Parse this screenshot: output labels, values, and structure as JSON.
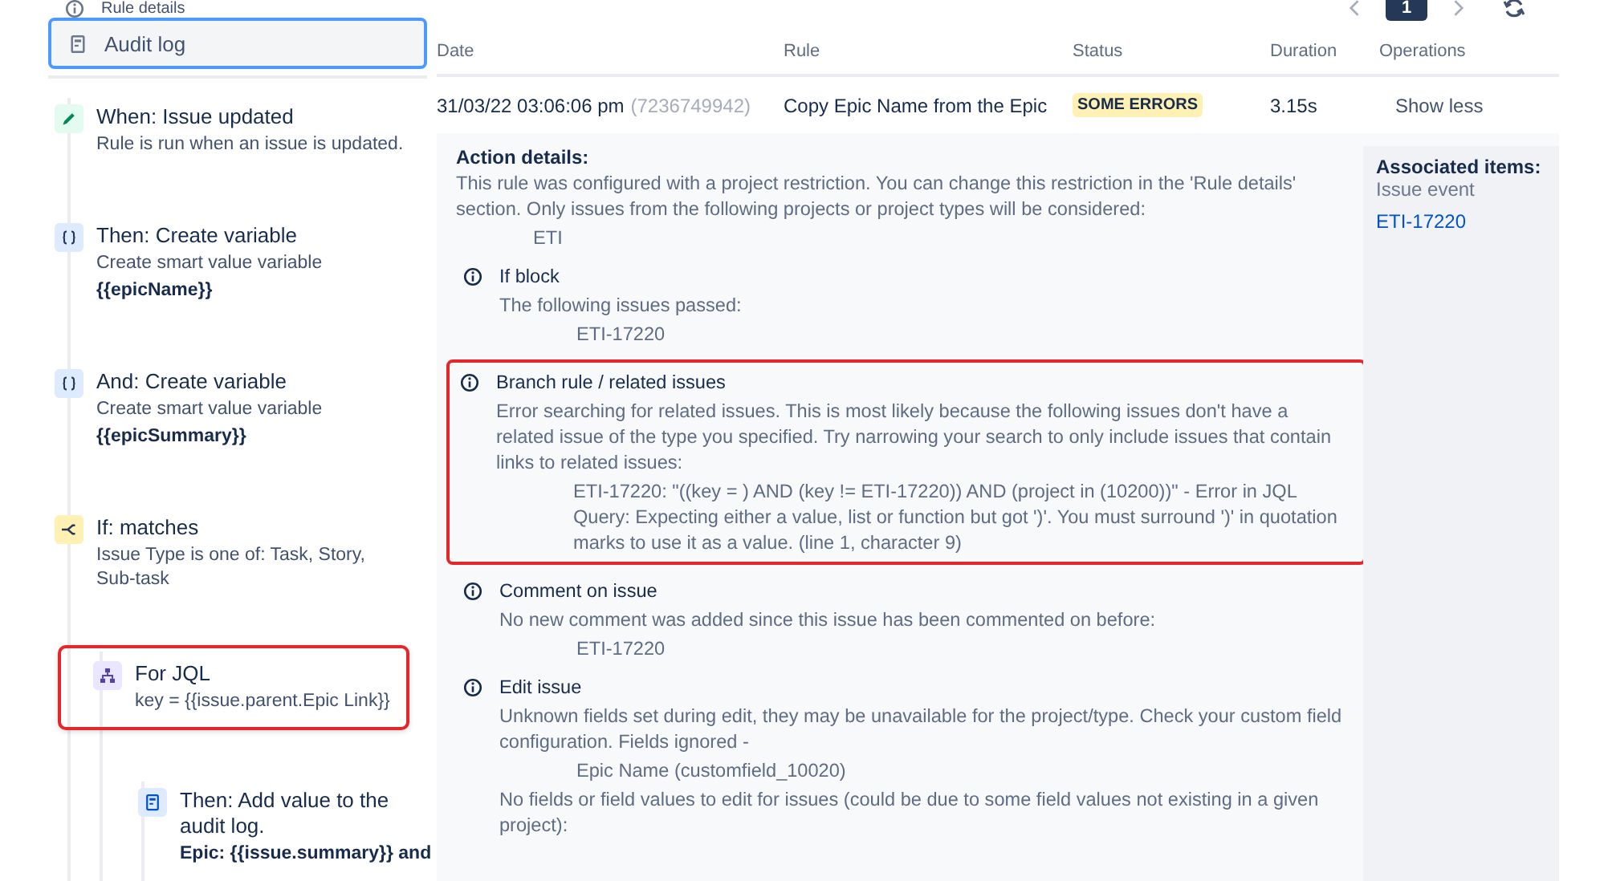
{
  "sidebar": {
    "nav": [
      {
        "label": "Rule details",
        "selected": false,
        "kind": "info"
      },
      {
        "label": "Audit log",
        "selected": true,
        "kind": "log"
      }
    ],
    "steps": [
      {
        "kind": "trigger",
        "title": "When: Issue updated",
        "lines": [
          "Rule is run when an issue is updated."
        ],
        "highlighted": false
      },
      {
        "kind": "variable",
        "title": "Then: Create variable",
        "lines": [
          "Create smart value variable",
          "**{{epicName}}**"
        ],
        "highlighted": false
      },
      {
        "kind": "variable",
        "title": "And: Create variable",
        "lines": [
          "Create smart value variable",
          "**{{epicSummary}}**"
        ],
        "highlighted": false
      },
      {
        "kind": "condition",
        "title": "If: matches",
        "lines": [
          "Issue Type is one of: Task, Story, Sub-task"
        ],
        "highlighted": false,
        "children": [
          {
            "kind": "branch",
            "title": "For JQL",
            "lines": [
              "key = {{issue.parent.Epic Link}}"
            ],
            "highlighted": true,
            "children": [
              {
                "kind": "log",
                "title": "Then: Add value to the audit log.",
                "lines": [
                  "**Epic: {{issue.summary}} and**"
                ],
                "highlighted": false
              }
            ]
          }
        ]
      }
    ]
  },
  "pagination": {
    "pages": [
      {
        "label": "1",
        "selected": true
      }
    ]
  },
  "table": {
    "columns": [
      "Date",
      "Rule",
      "Status",
      "Duration",
      "Operations"
    ],
    "row": {
      "date": "31/03/22 03:06:06 pm",
      "id": "(7236749942)",
      "rule": "Copy Epic Name from the Epic",
      "status": "SOME ERRORS",
      "duration": "3.15s",
      "operation": "Show less"
    }
  },
  "details": {
    "heading": "Action details:",
    "blocks": [
      {
        "kind": "plain",
        "highlighted": false,
        "paragraphs": [
          {
            "kind": "text",
            "text": "This rule was configured with a project restriction. You can change this restriction in the 'Rule details' section. Only issues from the following projects or project types will be considered:"
          },
          {
            "kind": "value",
            "text": "ETI"
          }
        ]
      },
      {
        "kind": "info",
        "title": "If block",
        "highlighted": false,
        "paragraphs": [
          {
            "kind": "text",
            "text": "The following issues passed:"
          },
          {
            "kind": "value",
            "text": "ETI-17220"
          }
        ]
      },
      {
        "kind": "info",
        "title": "Branch rule / related issues",
        "highlighted": true,
        "paragraphs": [
          {
            "kind": "text",
            "text": "Error searching for related issues. This is most likely because the following issues don't have a related issue of the type you specified. Try narrowing your search to only include issues that contain links to related issues:"
          },
          {
            "kind": "value",
            "text": "ETI-17220: \"((key = ) AND (key != ETI-17220)) AND (project in (10200))\" - Error in JQL Query: Expecting either a value, list or function but got ')'. You must surround ')' in quotation marks to use it as a value. (line 1, character 9)"
          }
        ]
      },
      {
        "kind": "info",
        "title": "Comment on issue",
        "highlighted": false,
        "paragraphs": [
          {
            "kind": "text",
            "text": "No new comment was added since this issue has been commented on before:"
          },
          {
            "kind": "value",
            "text": "ETI-17220"
          }
        ]
      },
      {
        "kind": "info",
        "title": "Edit issue",
        "highlighted": false,
        "paragraphs": [
          {
            "kind": "text",
            "text": "Unknown fields set during edit, they may be unavailable for the project/type. Check your custom field configuration. Fields ignored -"
          },
          {
            "kind": "value",
            "text": "Epic Name (customfield_10020)"
          },
          {
            "kind": "text",
            "text": "No fields or field values to edit for issues (could be due to some field values not existing in a given project):"
          }
        ]
      }
    ],
    "associated": {
      "heading": "Associated items:",
      "subheading": "Issue event",
      "links": [
        "ETI-17220"
      ]
    }
  }
}
